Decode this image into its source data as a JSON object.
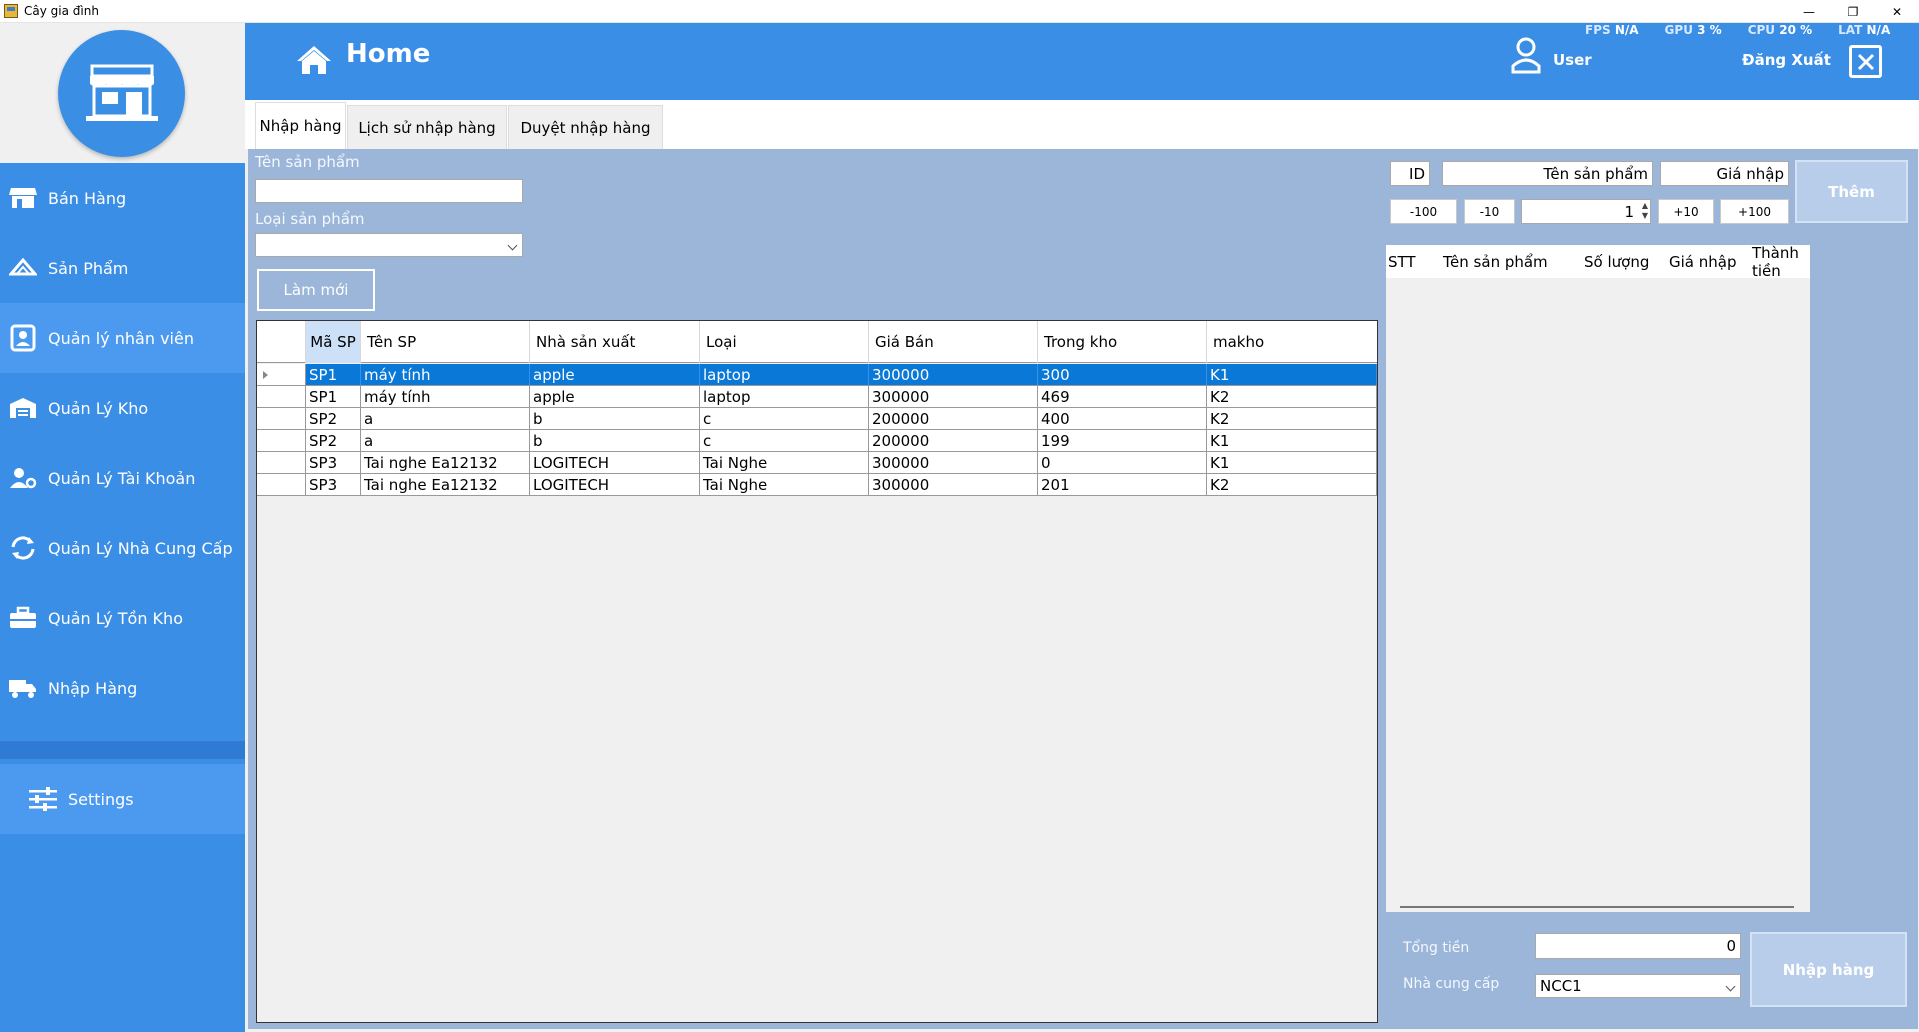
{
  "window": {
    "title": "Cây gia đình",
    "controls": [
      "—",
      "❐",
      "✕"
    ]
  },
  "header": {
    "title": "Home",
    "user_label": "User",
    "logout_label": "Đăng Xuất",
    "stats": [
      {
        "label": "FPS",
        "value": "N/A"
      },
      {
        "label": "GPU",
        "value": "3 %"
      },
      {
        "label": "CPU",
        "value": "20 %"
      },
      {
        "label": "LAT",
        "value": "N/A"
      }
    ]
  },
  "sidebar": {
    "items": [
      {
        "label": "Bán Hàng",
        "icon": "store-icon"
      },
      {
        "label": "Sản Phẩm",
        "icon": "box-icon"
      },
      {
        "label": "Quản lý nhân viên",
        "icon": "id-card-icon"
      },
      {
        "label": "Quản Lý Kho",
        "icon": "warehouse-icon"
      },
      {
        "label": "Quản Lý Tài Khoản",
        "icon": "user-gear-icon"
      },
      {
        "label": "Quản Lý Nhà Cung Cấp",
        "icon": "refresh-icon"
      },
      {
        "label": "Quản Lý Tồn Kho",
        "icon": "toolbox-icon"
      },
      {
        "label": "Nhập Hàng",
        "icon": "truck-icon"
      }
    ],
    "active_index": 2,
    "settings_label": "Settings"
  },
  "tabs": [
    {
      "label": "Nhập hàng"
    },
    {
      "label": "Lịch sử nhập hàng"
    },
    {
      "label": "Duyệt nhập hàng"
    }
  ],
  "filters": {
    "name_label": "Tên sản phẩm",
    "name_value": "",
    "type_label": "Loại sản phẩm",
    "type_value": "",
    "refresh_label": "Làm mới"
  },
  "products": {
    "columns": [
      "Mã SP",
      "Tên SP",
      "Nhà sản xuất",
      "Loại",
      "Giá Bán",
      "Trong kho",
      "makho"
    ],
    "rows": [
      [
        "SP1",
        "máy tính",
        "apple",
        "laptop",
        "300000",
        "300",
        "K1"
      ],
      [
        "SP1",
        "máy tính",
        "apple",
        "laptop",
        "300000",
        "469",
        "K2"
      ],
      [
        "SP2",
        "a",
        "b",
        "c",
        "200000",
        "400",
        "K2"
      ],
      [
        "SP2",
        "a",
        "b",
        "c",
        "200000",
        "199",
        "K1"
      ],
      [
        "SP3",
        "Tai nghe Ea12132",
        "LOGITECH",
        "Tai Nghe",
        "300000",
        "0",
        "K1"
      ],
      [
        "SP3",
        "Tai nghe Ea12132",
        "LOGITECH",
        "Tai Nghe",
        "300000",
        "201",
        "K2"
      ]
    ],
    "selected_row": 0
  },
  "entry": {
    "id_label": "ID",
    "name_label": "Tên sản phẩm",
    "price_label": "Giá nhập",
    "add_label": "Thêm",
    "minus100": "-100",
    "minus10": "-10",
    "quantity": "1",
    "plus10": "+10",
    "plus100": "+100"
  },
  "cart": {
    "columns": [
      "STT",
      "Tên sản phẩm",
      "Số lượng",
      "Giá nhập",
      "Thành tiền"
    ]
  },
  "footer": {
    "total_label": "Tổng tiền",
    "total_value": "0",
    "supplier_label": "Nhà cung cấp",
    "supplier_value": "NCC1",
    "import_label": "Nhập hàng"
  }
}
